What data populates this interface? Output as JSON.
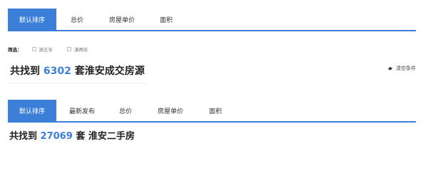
{
  "section1": {
    "tabs": [
      "默认排序",
      "总价",
      "房屋单价",
      "面积"
    ],
    "filter": {
      "label": "筛选：",
      "options": [
        "满五年",
        "满两年"
      ]
    },
    "result": {
      "prefix": "共找到",
      "count": "6302",
      "suffix": "套淮安成交房源"
    },
    "clear_label": "清空条件"
  },
  "section2": {
    "tabs": [
      "默认排序",
      "最新发布",
      "总价",
      "房屋单价",
      "面积"
    ],
    "result": {
      "prefix": "共找到",
      "count": "27069",
      "suffix": "套 淮安二手房"
    }
  },
  "colors": {
    "accent": "#3b7fd8",
    "text": "#222222"
  }
}
